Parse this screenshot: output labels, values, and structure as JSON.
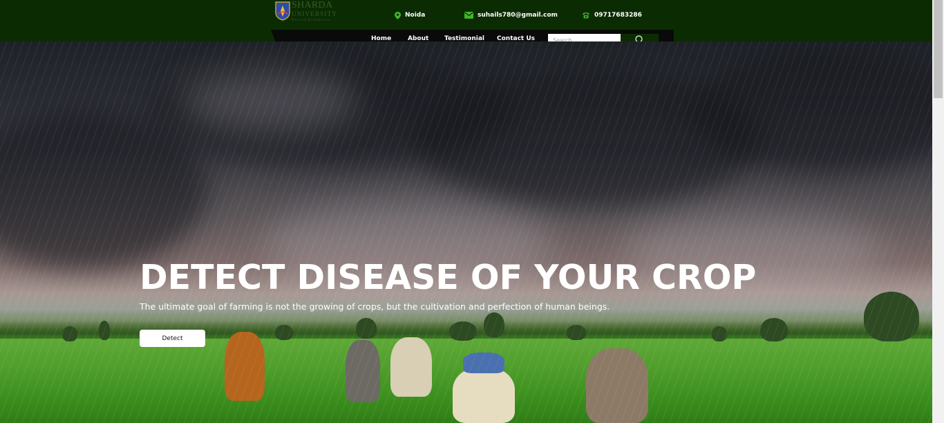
{
  "brand": {
    "name_line1": "SHARDA",
    "name_line2": "UNIVERSITY",
    "tagline": "Beyond Boundaries",
    "colors": {
      "topbar": "#0b2c02",
      "nav": "#0a0a0a"
    }
  },
  "contacts": {
    "location": {
      "icon": "map-pin-icon",
      "text": "Noida"
    },
    "email": {
      "icon": "envelope-icon",
      "text": "suhails780@gmail.com"
    },
    "phone": {
      "icon": "phone-icon",
      "text": "09717683286"
    }
  },
  "nav": {
    "items": [
      {
        "label": "Home"
      },
      {
        "label": "About"
      },
      {
        "label": "Testimonial"
      },
      {
        "label": "Contact Us"
      }
    ],
    "search": {
      "placeholder": "Search",
      "icon": "search-icon"
    }
  },
  "hero": {
    "title": "DETECT DISEASE OF YOUR CROP",
    "subtitle": "The ultimate goal of farming is not the growing of crops, but the cultivation and perfection of human beings.",
    "button_label": "Detect"
  }
}
